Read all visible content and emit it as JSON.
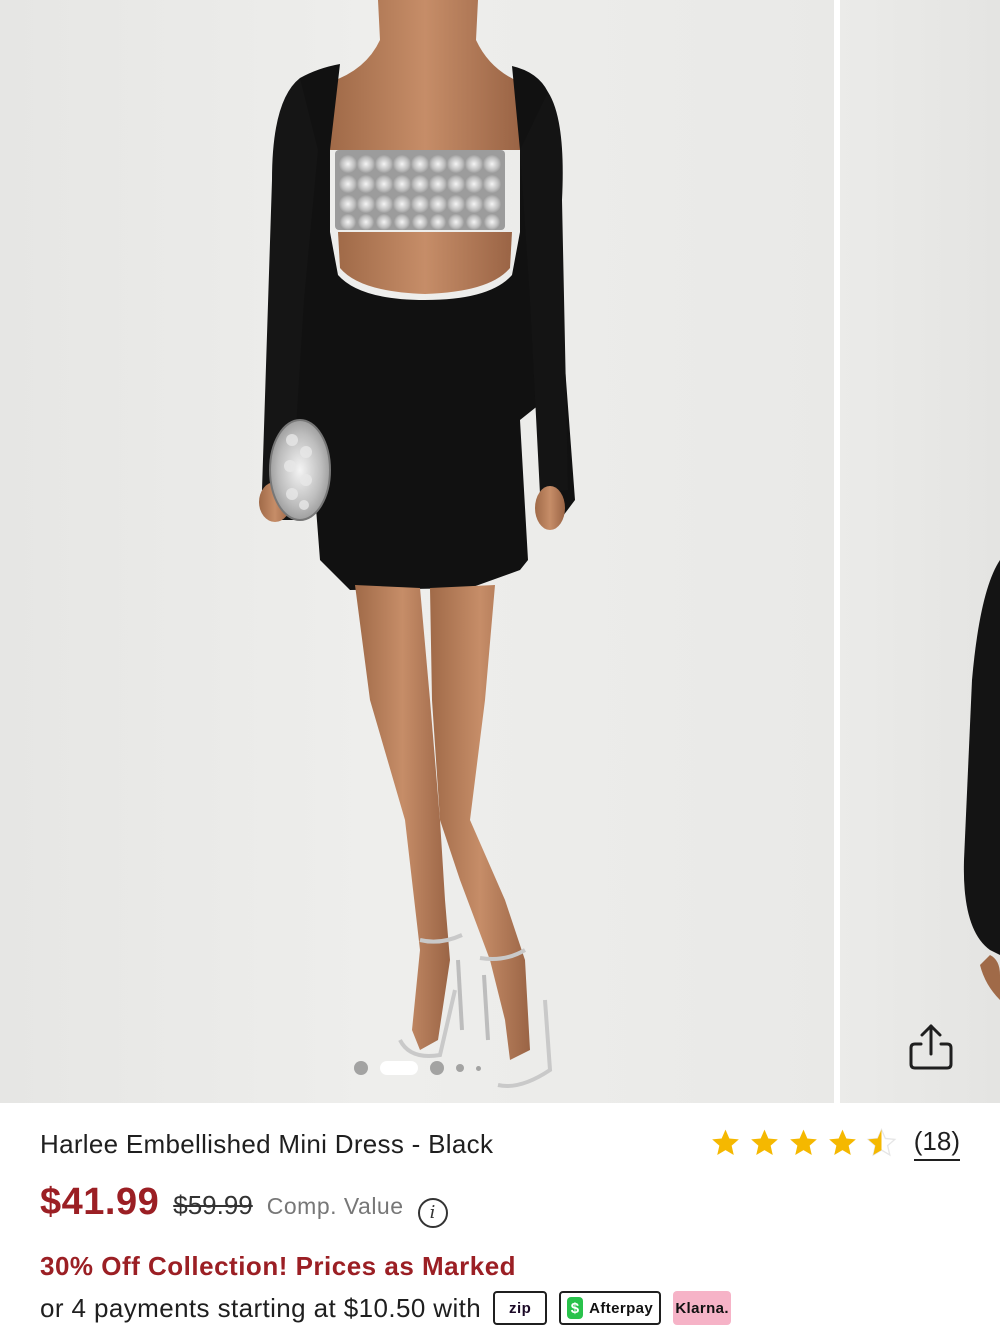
{
  "gallery": {
    "image_alt": "Model wearing black long sleeve mini dress with silver embellished cutout",
    "slides_count": 5,
    "active_slide": 2,
    "share_icon": "share-icon"
  },
  "product": {
    "title": "Harlee Embellished Mini Dress - Black",
    "rating": 4.5,
    "review_count": "(18)",
    "sale_price": "$41.99",
    "original_price": "$59.99",
    "comp_value_label": "Comp. Value",
    "info_icon_glyph": "i",
    "promo": "30% Off Collection! Prices as Marked",
    "payments_text": "or 4 payments starting at $10.50 with",
    "payment_badges": {
      "zip": "zip",
      "afterpay": "Afterpay",
      "afterpay_icon_glyph": "$",
      "klarna": "Klarna."
    }
  },
  "colors": {
    "sale_price": "#9b1f24",
    "star": "#f5b800",
    "afterpay_green": "#29c24b",
    "klarna_pink": "#f6b3c7",
    "background_photo": "#eaeae8"
  }
}
